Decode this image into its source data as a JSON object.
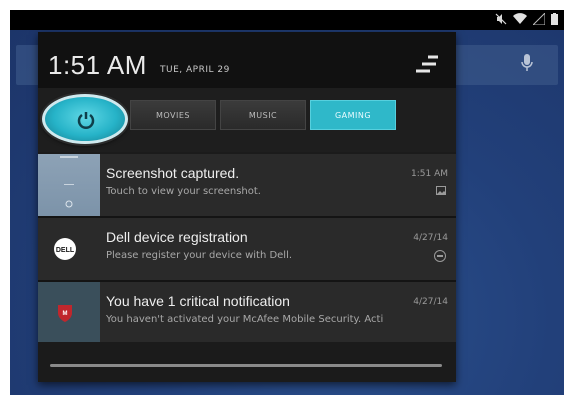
{
  "header": {
    "time": "1:51 AM",
    "date": "TUE, APRIL 29"
  },
  "toggles": {
    "modes": [
      {
        "label": "MOVIES",
        "active": false
      },
      {
        "label": "MUSIC",
        "active": false
      },
      {
        "label": "GAMING",
        "active": true
      }
    ]
  },
  "notifications": [
    {
      "title": "Screenshot captured.",
      "body": "Touch to view your screenshot.",
      "time": "1:51 AM",
      "icon": "image-icon"
    },
    {
      "title": "Dell device registration",
      "body": "Please register your device with Dell.",
      "time": "4/27/14",
      "icon": "dell-icon"
    },
    {
      "title": "You have 1 critical notification",
      "body": "You haven't activated your McAfee Mobile Security. Acti",
      "time": "4/27/14",
      "icon": "mcafee-icon"
    }
  ],
  "colors": {
    "accent": "#2fb8c9",
    "wallpaper": "#23427a",
    "shade": "#1b1b1b"
  }
}
